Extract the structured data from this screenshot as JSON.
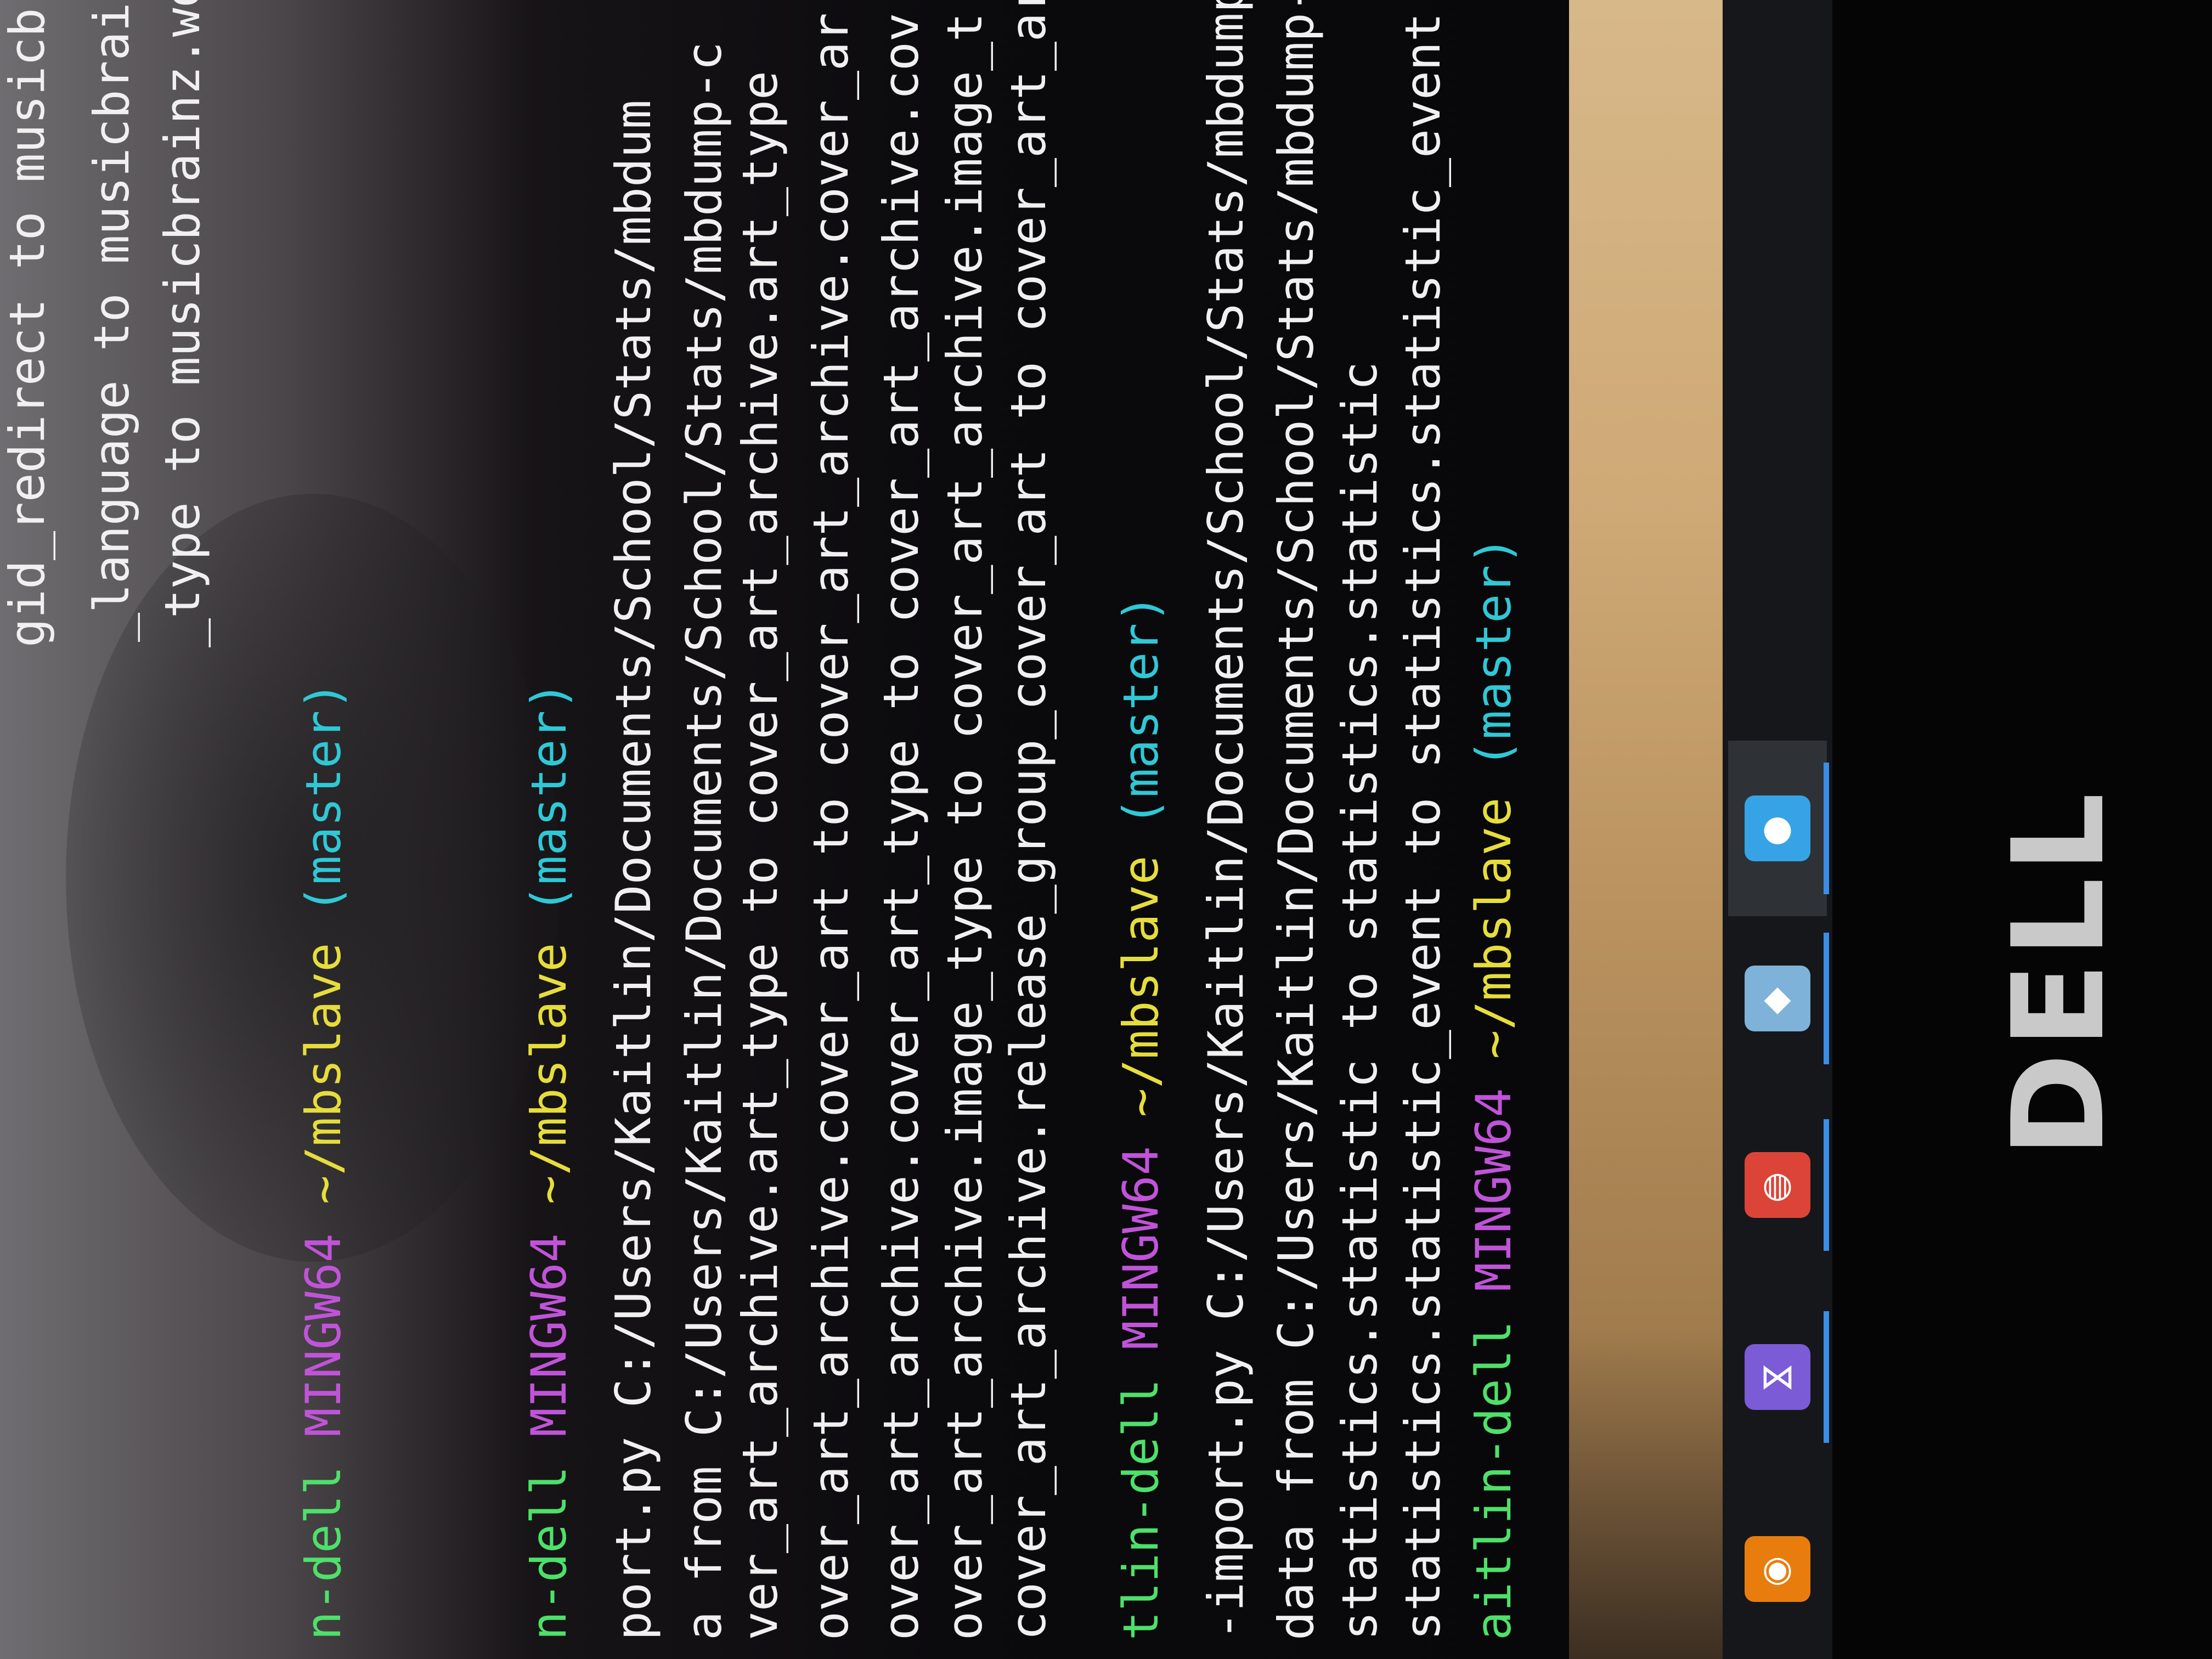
{
  "terminal": {
    "lines": [
      {
        "text": "gid_redirect to musicbrainz.artist_gid_redirect"
      },
      {
        "text": "_language to musicbrainz.work_language"
      },
      {
        "text": "_type to musicbrainz.work_type"
      },
      {
        "prompt": {
          "user": "n-dell",
          "host": "MINGW64",
          "path": "~/mbslave",
          "branch": "(master)"
        }
      },
      {
        "prompt": {
          "user": "n-dell",
          "host": "MINGW64",
          "path": "~/mbslave",
          "branch": "(master)"
        }
      },
      {
        "text": "port.py C:/Users/Kaitlin/Documents/School/Stats/mbdum"
      },
      {
        "text": "a from C:/Users/Kaitlin/Documents/School/Stats/mbdump-c"
      },
      {
        "text": "ver_art_archive.art_type to cover_art_archive.art_type"
      },
      {
        "text": "over_art_archive.cover_art to cover_art_archive.cover_ar"
      },
      {
        "text": "over_art_archive.cover_art_type to cover_art_archive.cov"
      },
      {
        "text": "over_art_archive.image_type to cover_art_archive.image_t"
      },
      {
        "text": "cover_art_archive.release_group_cover_art to cover_art_ar"
      },
      {
        "prompt": {
          "user": "tlin-dell",
          "host": "MINGW64",
          "path": "~/mbslave",
          "branch": "(master)"
        }
      },
      {
        "text": "-import.py C:/Users/Kaitlin/Documents/School/Stats/mbdump-"
      },
      {
        "text": "data from C:/Users/Kaitlin/Documents/School/Stats/mbdump-st"
      },
      {
        "text": "statistics.statistic to statistics.statistic"
      },
      {
        "text": "statistics.statistic_event to statistics.statistic_event"
      },
      {
        "prompt": {
          "user": "aitlin-dell",
          "host": "MINGW64",
          "path": "~/mbslave",
          "branch": "(master)"
        }
      }
    ]
  },
  "taskbar": {
    "icons": [
      {
        "name": "blender-icon",
        "glyph": "◉",
        "color": "#e87d0d"
      },
      {
        "name": "visual-studio-icon",
        "glyph": "⋈",
        "color": "#7b5bd6"
      },
      {
        "name": "chrome-icon",
        "glyph": "◍",
        "color": "#db4437"
      },
      {
        "name": "file-explorer-icon",
        "glyph": "◆",
        "color": "#7fb2d8"
      },
      {
        "name": "app-icon",
        "glyph": "●",
        "color": "#36a3e6"
      }
    ]
  },
  "bezel": {
    "brand": "DELL"
  }
}
